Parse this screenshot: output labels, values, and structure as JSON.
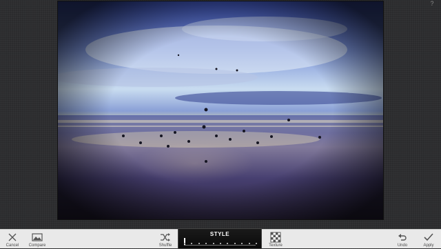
{
  "help": {
    "icon": "question-icon",
    "text": "?"
  },
  "photo": {
    "description_icon": "photo-canvas"
  },
  "toolbar": {
    "cancel": {
      "label": "Cancel",
      "icon": "close-icon"
    },
    "compare": {
      "label": "Compare",
      "icon": "image-icon"
    },
    "shuffle": {
      "label": "Shuffle",
      "icon": "shuffle-icon"
    },
    "style": {
      "label": "STYLE",
      "position": 0.0
    },
    "texture": {
      "label": "Texture",
      "icon": "checker-icon"
    },
    "undo": {
      "label": "Undo",
      "icon": "undo-icon"
    },
    "apply": {
      "label": "Apply",
      "icon": "check-icon"
    }
  },
  "colors": {
    "toolbar_bg": "#e9e9e9",
    "icon": "#555555"
  }
}
